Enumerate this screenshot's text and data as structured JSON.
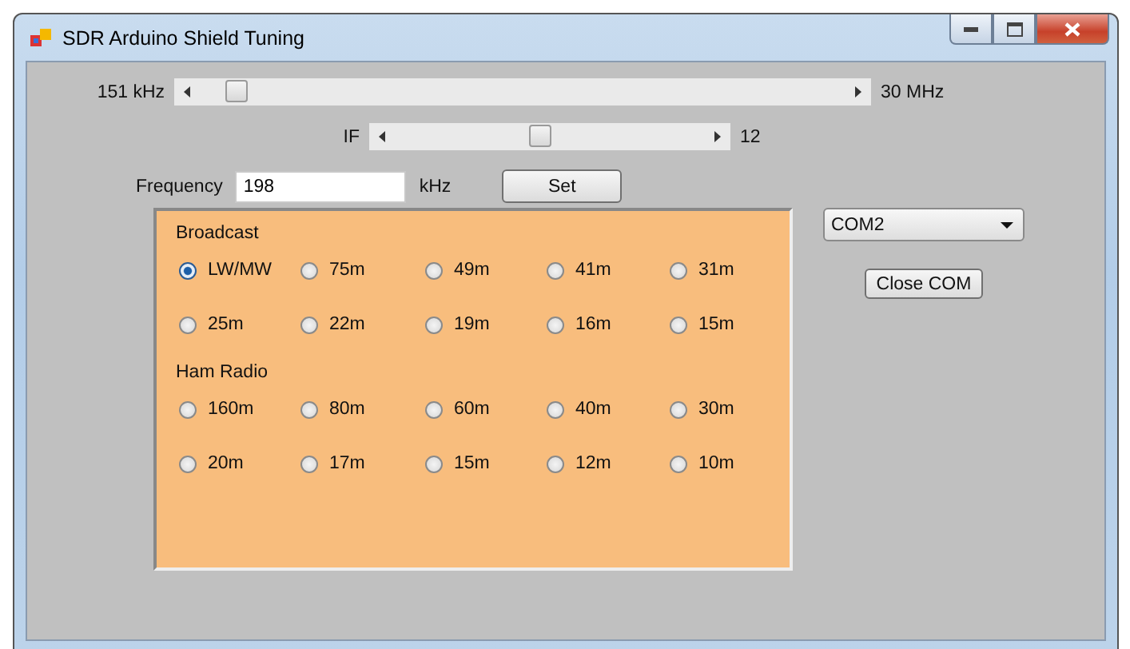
{
  "window": {
    "title": "SDR Arduino Shield Tuning"
  },
  "tuning_slider": {
    "min_label": "151 kHz",
    "max_label": "30 MHz"
  },
  "if_slider": {
    "label": "IF",
    "value": "12"
  },
  "frequency": {
    "label": "Frequency",
    "value": "198",
    "unit": "kHz",
    "button": "Set"
  },
  "band_groups": [
    {
      "title": "Broadcast",
      "options": [
        {
          "label": "LW/MW",
          "selected": true
        },
        {
          "label": "75m",
          "selected": false
        },
        {
          "label": "49m",
          "selected": false
        },
        {
          "label": "41m",
          "selected": false
        },
        {
          "label": "31m",
          "selected": false
        },
        {
          "label": "25m",
          "selected": false
        },
        {
          "label": "22m",
          "selected": false
        },
        {
          "label": "19m",
          "selected": false
        },
        {
          "label": "16m",
          "selected": false
        },
        {
          "label": "15m",
          "selected": false
        }
      ]
    },
    {
      "title": "Ham Radio",
      "options": [
        {
          "label": "160m",
          "selected": false
        },
        {
          "label": "80m",
          "selected": false
        },
        {
          "label": "60m",
          "selected": false
        },
        {
          "label": "40m",
          "selected": false
        },
        {
          "label": "30m",
          "selected": false
        },
        {
          "label": "20m",
          "selected": false
        },
        {
          "label": "17m",
          "selected": false
        },
        {
          "label": "15m",
          "selected": false
        },
        {
          "label": "12m",
          "selected": false
        },
        {
          "label": "10m",
          "selected": false
        }
      ]
    }
  ],
  "com_port": {
    "value": "COM2"
  },
  "close_button": "Close COM"
}
